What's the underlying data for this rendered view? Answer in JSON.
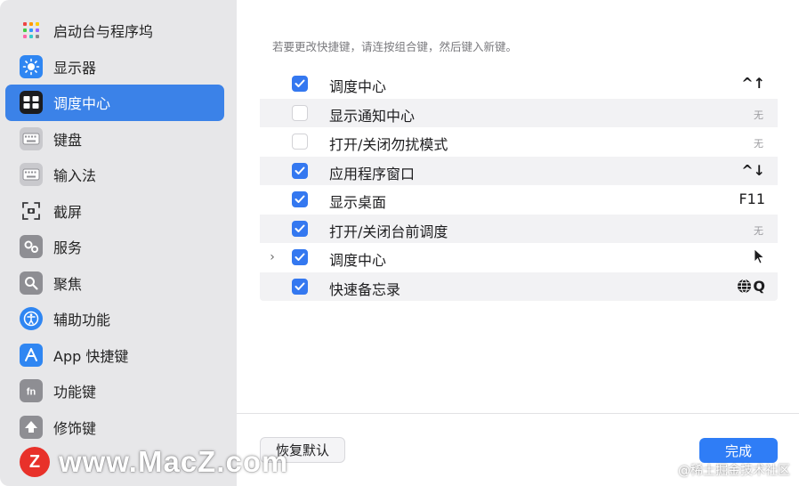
{
  "sidebar": {
    "items": [
      {
        "label": "启动台与程序坞",
        "icon": "launchpad-icon"
      },
      {
        "label": "显示器",
        "icon": "display-icon"
      },
      {
        "label": "调度中心",
        "icon": "mission-control-icon",
        "selected": true
      },
      {
        "label": "键盘",
        "icon": "keyboard-icon"
      },
      {
        "label": "输入法",
        "icon": "input-method-icon"
      },
      {
        "label": "截屏",
        "icon": "screenshot-icon"
      },
      {
        "label": "服务",
        "icon": "services-icon"
      },
      {
        "label": "聚焦",
        "icon": "spotlight-icon"
      },
      {
        "label": "辅助功能",
        "icon": "accessibility-icon"
      },
      {
        "label": "App 快捷键",
        "icon": "app-shortcuts-icon"
      },
      {
        "label": "功能键",
        "icon": "function-keys-icon"
      },
      {
        "label": "修饰键",
        "icon": "modifier-keys-icon"
      }
    ]
  },
  "main": {
    "hint": "若要更改快捷键，请连按组合键，然后键入新键。",
    "rows": [
      {
        "label": "调度中心",
        "checked": true,
        "shortcut": "^↑"
      },
      {
        "label": "显示通知中心",
        "checked": false,
        "shortcut": "无"
      },
      {
        "label": "打开/关闭勿扰模式",
        "checked": false,
        "shortcut": "无"
      },
      {
        "label": "应用程序窗口",
        "checked": true,
        "shortcut": "^↓"
      },
      {
        "label": "显示桌面",
        "checked": true,
        "shortcut": "F11"
      },
      {
        "label": "打开/关闭台前调度",
        "checked": true,
        "shortcut": "无"
      },
      {
        "label": "调度中心",
        "checked": true,
        "shortcut": "",
        "expandable": true
      },
      {
        "label": "快速备忘录",
        "checked": true,
        "shortcut": "Q"
      }
    ],
    "restore_label": "恢复默认",
    "done_label": "完成"
  },
  "watermark": {
    "logo_letter": "Z",
    "text": "www.MacZ.com",
    "credit": "@稀土掘金技术社区"
  },
  "colors": {
    "accent": "#3478f0",
    "selected_sidebar": "#3b82e8",
    "sidebar_bg": "#e7e7e9"
  }
}
